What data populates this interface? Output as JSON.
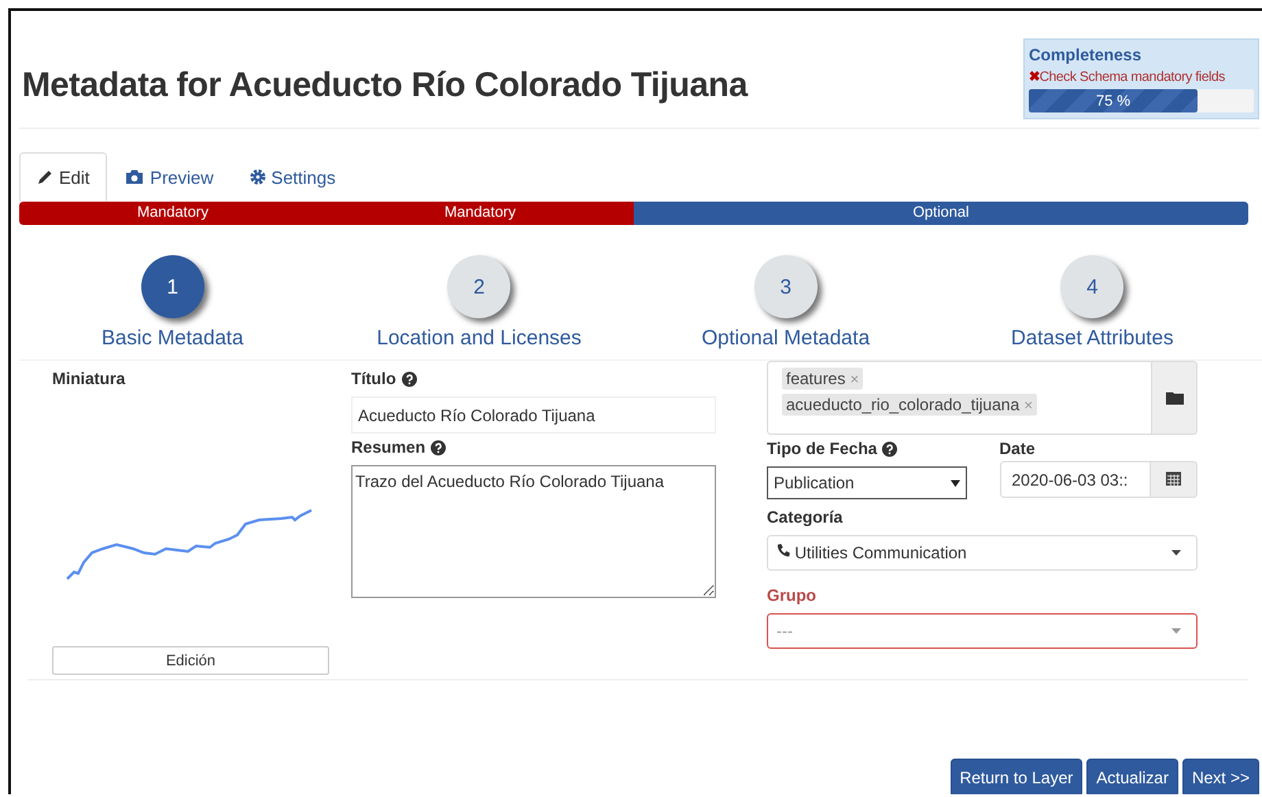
{
  "title": "Metadata for Acueducto Río Colorado Tijuana",
  "completeness": {
    "heading": "Completeness",
    "warning_icon": "✖",
    "warning": "Check Schema mandatory fields",
    "level": 0.75,
    "reading": "75 %"
  },
  "tabs": [
    {
      "label": "Edit",
      "selected": true
    },
    {
      "label": "Preview",
      "selected": false
    },
    {
      "label": "Settings",
      "selected": false
    }
  ],
  "segments": [
    {
      "label": "Mandatory",
      "kind": "mandatory"
    },
    {
      "label": "Mandatory",
      "kind": "mandatory"
    },
    {
      "label": "Optional",
      "kind": "optional"
    }
  ],
  "steps": [
    {
      "number": "1",
      "label": "Basic Metadata",
      "selected": true
    },
    {
      "number": "2",
      "label": "Location and Licenses",
      "selected": false
    },
    {
      "number": "3",
      "label": "Optional Metadata",
      "selected": false
    },
    {
      "number": "4",
      "label": "Dataset Attributes",
      "selected": false
    }
  ],
  "thumbnail": {
    "label": "Miniatura",
    "button": "Edición"
  },
  "titulo": {
    "label": "Título",
    "value": "Acueducto Río Colorado Tijuana"
  },
  "resumen": {
    "label": "Resumen",
    "value": "Trazo del Acueducto Río Colorado Tijuana"
  },
  "keywords": [
    {
      "text": "features",
      "remove": "×"
    },
    {
      "text": "acueducto_rio_colorado_tijuana",
      "remove": "×"
    }
  ],
  "date_type": {
    "label": "Tipo de Fecha",
    "value": "Publication"
  },
  "date": {
    "label": "Date",
    "value": "2020-06-03 03::"
  },
  "category": {
    "label": "Categoría",
    "value": "Utilities Communication"
  },
  "group": {
    "label": "Grupo",
    "placeholder": "---",
    "error": true
  },
  "buttons": [
    "Return to Layer",
    "Actualizar",
    "Next >>"
  ]
}
